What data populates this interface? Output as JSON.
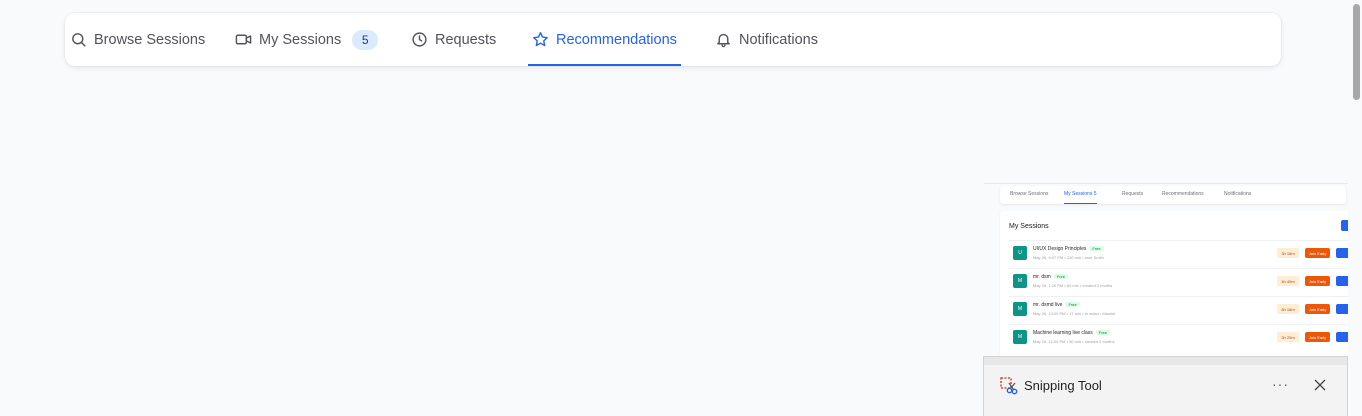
{
  "tabs": [
    {
      "label": "Browse Sessions",
      "icon": "search-icon"
    },
    {
      "label": "My Sessions",
      "icon": "video-icon",
      "badge": "5"
    },
    {
      "label": "Requests",
      "icon": "clock-icon"
    },
    {
      "label": "Recommendations",
      "icon": "star-icon",
      "active": true
    },
    {
      "label": "Notifications",
      "icon": "bell-icon"
    }
  ],
  "accent_color": "#2563eb",
  "thumbnail": {
    "tabs": [
      "Browse Sessions",
      "My Sessions",
      "Requests",
      "Recommendations",
      "Notifications"
    ],
    "my_sessions_badge": "5",
    "heading": "My Sessions",
    "rows": [
      {
        "avatar": "U",
        "title": "UI/UX Design Principles",
        "tag": "Free",
        "meta": "May 26, 9:07 PM • 120 min • user Smith",
        "time": "3h 16m",
        "action": "Join Early"
      },
      {
        "avatar": "M",
        "title": "mr. dsm",
        "tag": "Free",
        "meta": "May 26, 1:26 PM • 60 min • created 2 booths",
        "time": "4h 40m",
        "action": "Join Early"
      },
      {
        "avatar": "M",
        "title": "mr. dsmd live",
        "tag": "Free",
        "meta": "May 26, 10:00 PM • 17 min • in mdsd • Manish",
        "time": "8h 16m",
        "action": "Join Early"
      },
      {
        "avatar": "M",
        "title": "Machine learning live class",
        "tag": "Free",
        "meta": "May 26, 12:05 PM • 30 min • created 2 booths",
        "time": "3h 25m",
        "action": "Join Early"
      }
    ]
  },
  "snipping_tool": {
    "title": "Snipping Tool",
    "more": "···"
  }
}
